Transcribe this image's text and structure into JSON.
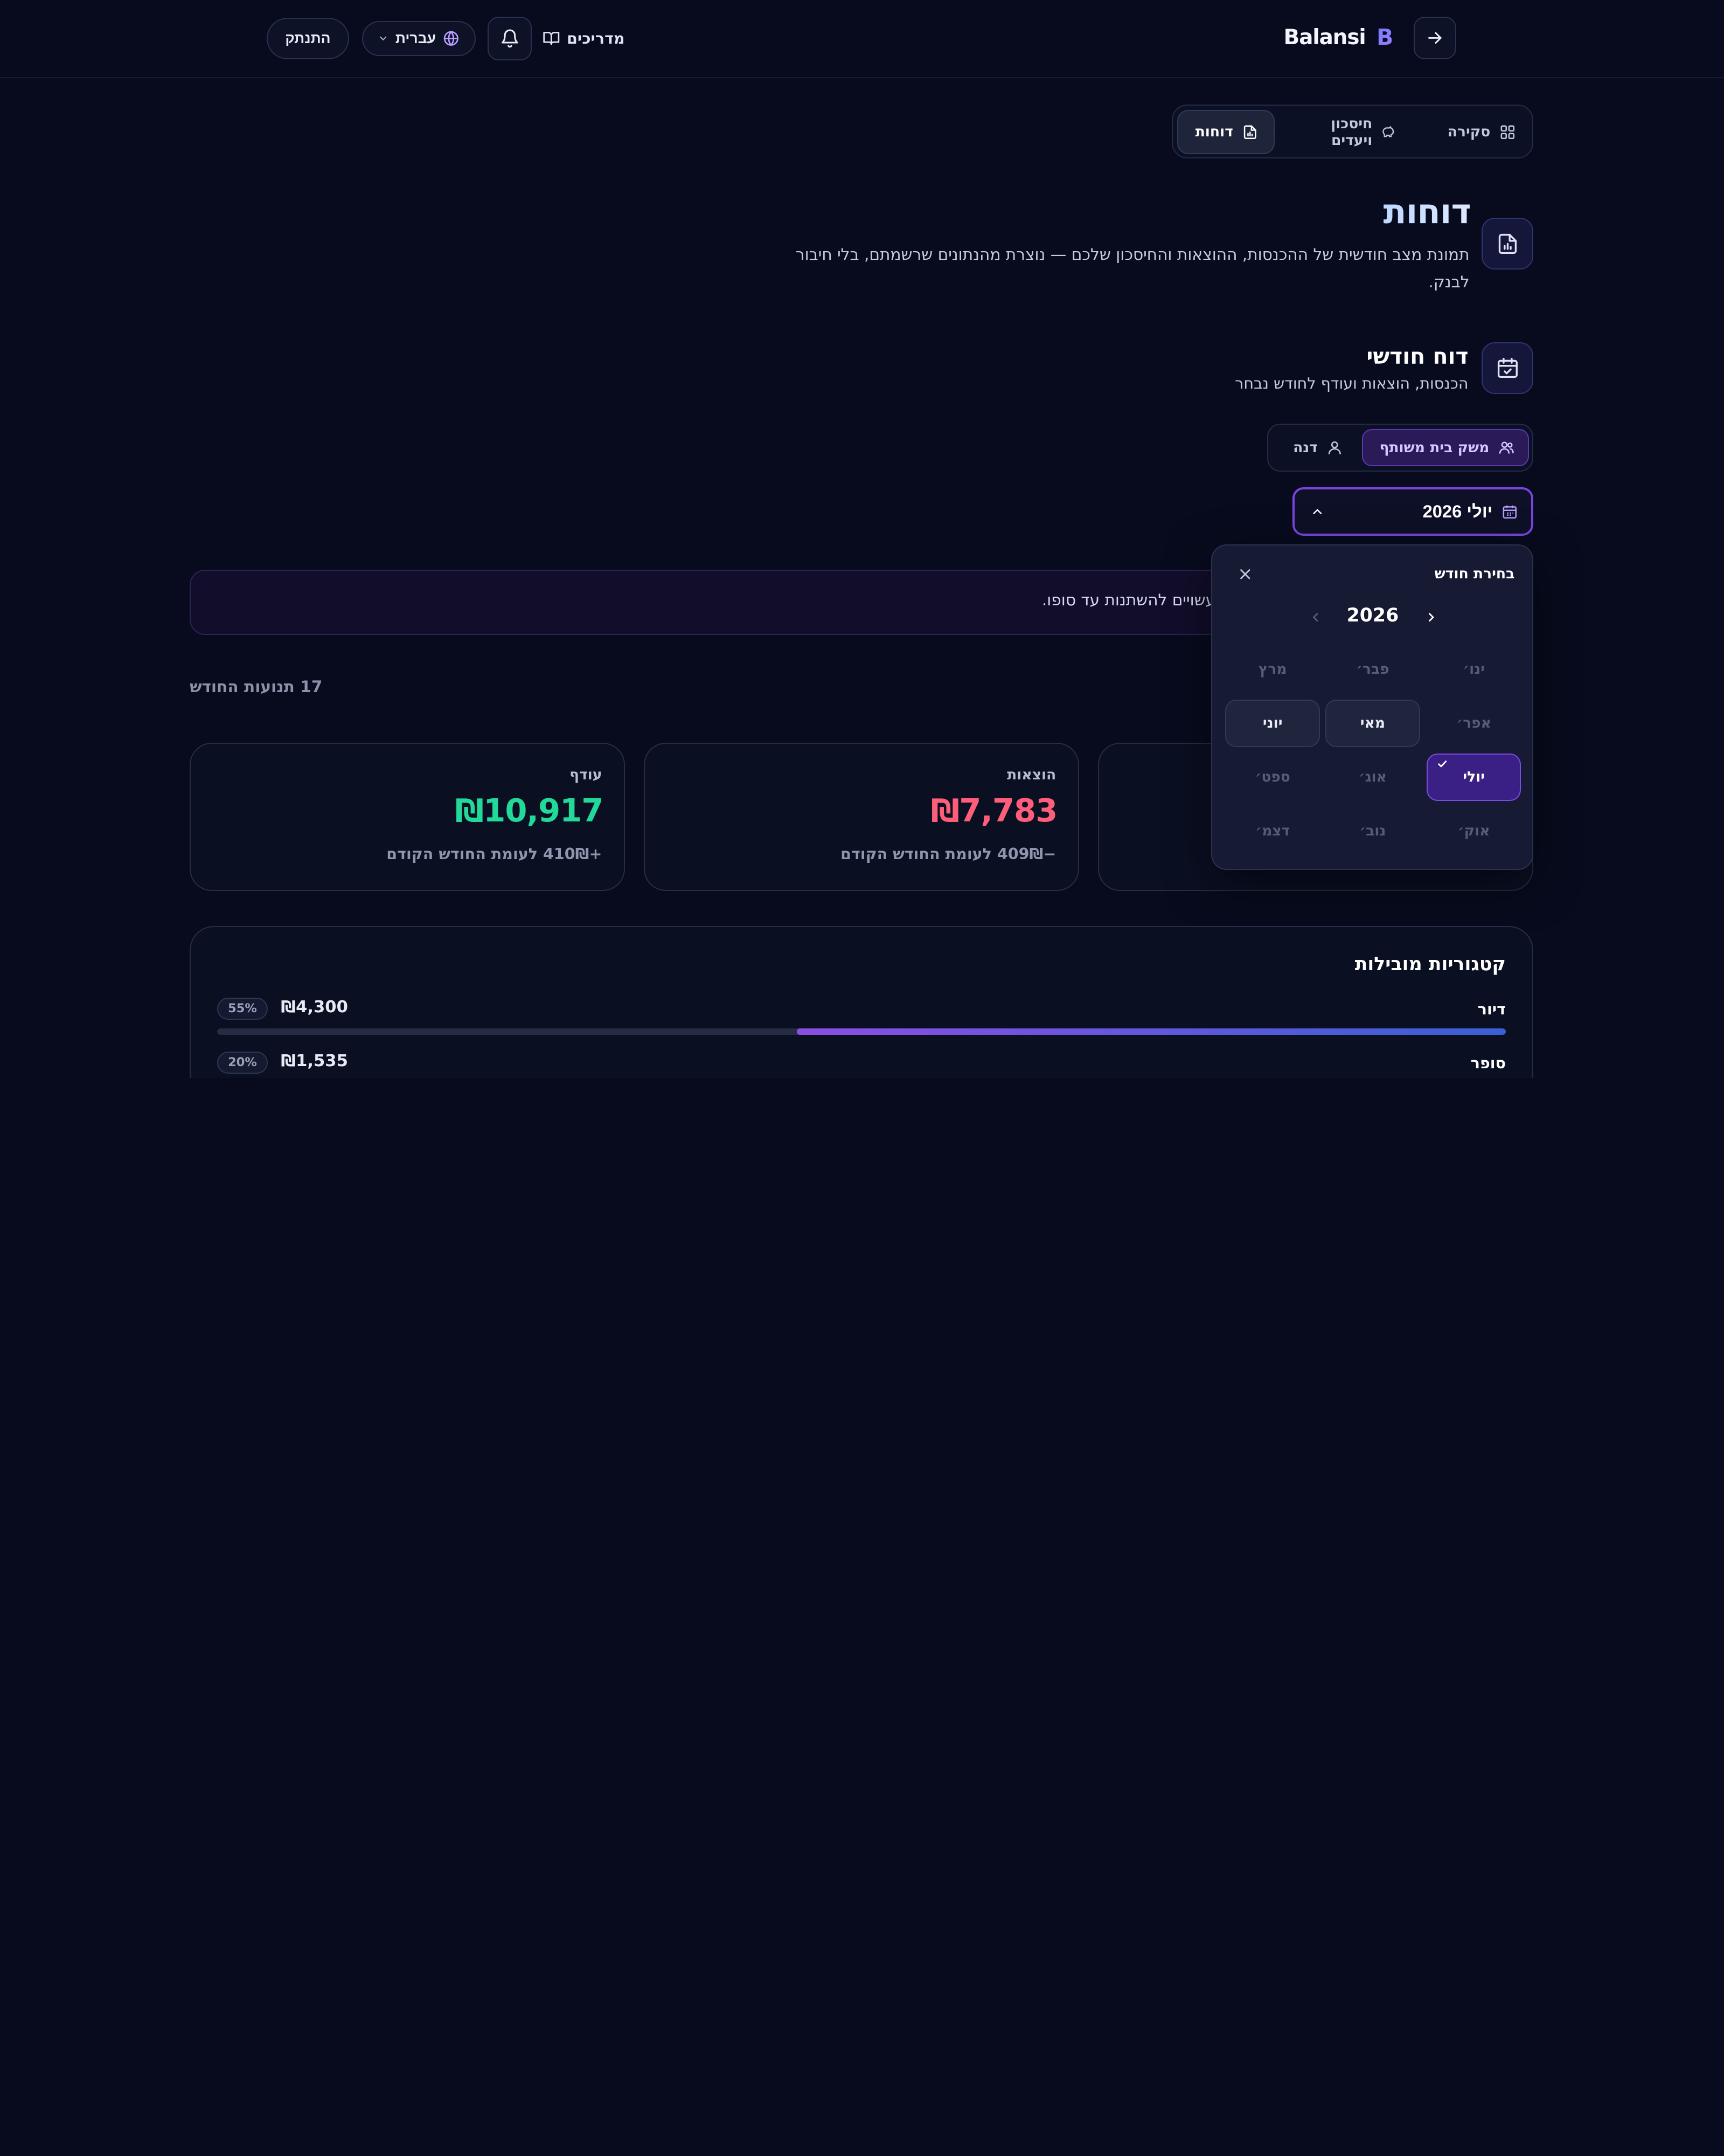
{
  "header": {
    "brand_name": "Balansi",
    "brand_mark": "B",
    "guides_label": "מדריכים",
    "language_label": "עברית",
    "logout_label": "התנתק"
  },
  "tabs": [
    {
      "label": "סקירה",
      "icon": "grid-icon",
      "active": false
    },
    {
      "label": "חיסכון ויעדים",
      "icon": "piggy-bank-icon",
      "active": false
    },
    {
      "label": "דוחות",
      "icon": "report-file-icon",
      "active": true
    }
  ],
  "page": {
    "title": "דוחות",
    "description": "תמונת מצב חודשית של ההכנסות, ההוצאות והחיסכון שלכם — נוצרת מהנתונים שרשמתם, בלי חיבור לבנק."
  },
  "monthly_report": {
    "title": "דוח חודשי",
    "subtitle": "הכנסות, הוצאות ועודף לחודש נבחר",
    "scope_options": [
      {
        "label": "משק בית משותף",
        "icon": "users-icon",
        "active": true
      },
      {
        "label": "דנה",
        "icon": "user-icon",
        "active": false
      }
    ],
    "selected_month": "יולי 2026",
    "banner_text": "עשויים להשתנות עד סופו.",
    "transactions_count": "17 תנועות החודש"
  },
  "stats": {
    "surplus": {
      "label": "עודף",
      "amount": "₪10,917",
      "delta": "+410₪ לעומת החודש הקודם"
    },
    "expenses": {
      "label": "הוצאות",
      "amount": "₪7,783",
      "delta": "−409₪ לעומת החודש הקודם"
    }
  },
  "month_picker": {
    "title": "בחירת חודש",
    "year": "2026",
    "months": [
      {
        "label": "ינו׳",
        "state": "disabled"
      },
      {
        "label": "פבר׳",
        "state": "disabled"
      },
      {
        "label": "מרץ",
        "state": "disabled"
      },
      {
        "label": "אפר׳",
        "state": "disabled"
      },
      {
        "label": "מאי",
        "state": "available"
      },
      {
        "label": "יוני",
        "state": "available"
      },
      {
        "label": "יולי",
        "state": "selected"
      },
      {
        "label": "אוג׳",
        "state": "disabled"
      },
      {
        "label": "ספט׳",
        "state": "disabled"
      },
      {
        "label": "אוק׳",
        "state": "disabled"
      },
      {
        "label": "נוב׳",
        "state": "disabled"
      },
      {
        "label": "דצמ׳",
        "state": "disabled"
      }
    ]
  },
  "categories": {
    "title": "קטגוריות מובילות",
    "items": [
      {
        "name": "דיור",
        "amount": "₪4,300",
        "percent": "55%",
        "share": 0.55
      },
      {
        "name": "סופר",
        "amount": "₪1,535",
        "percent": "20%",
        "share": 0.2
      }
    ]
  },
  "colors": {
    "background": "#070b1d",
    "accent_purple": "#7a44e0",
    "surplus_green": "#22d99a",
    "expense_red": "#ff5e7a"
  }
}
